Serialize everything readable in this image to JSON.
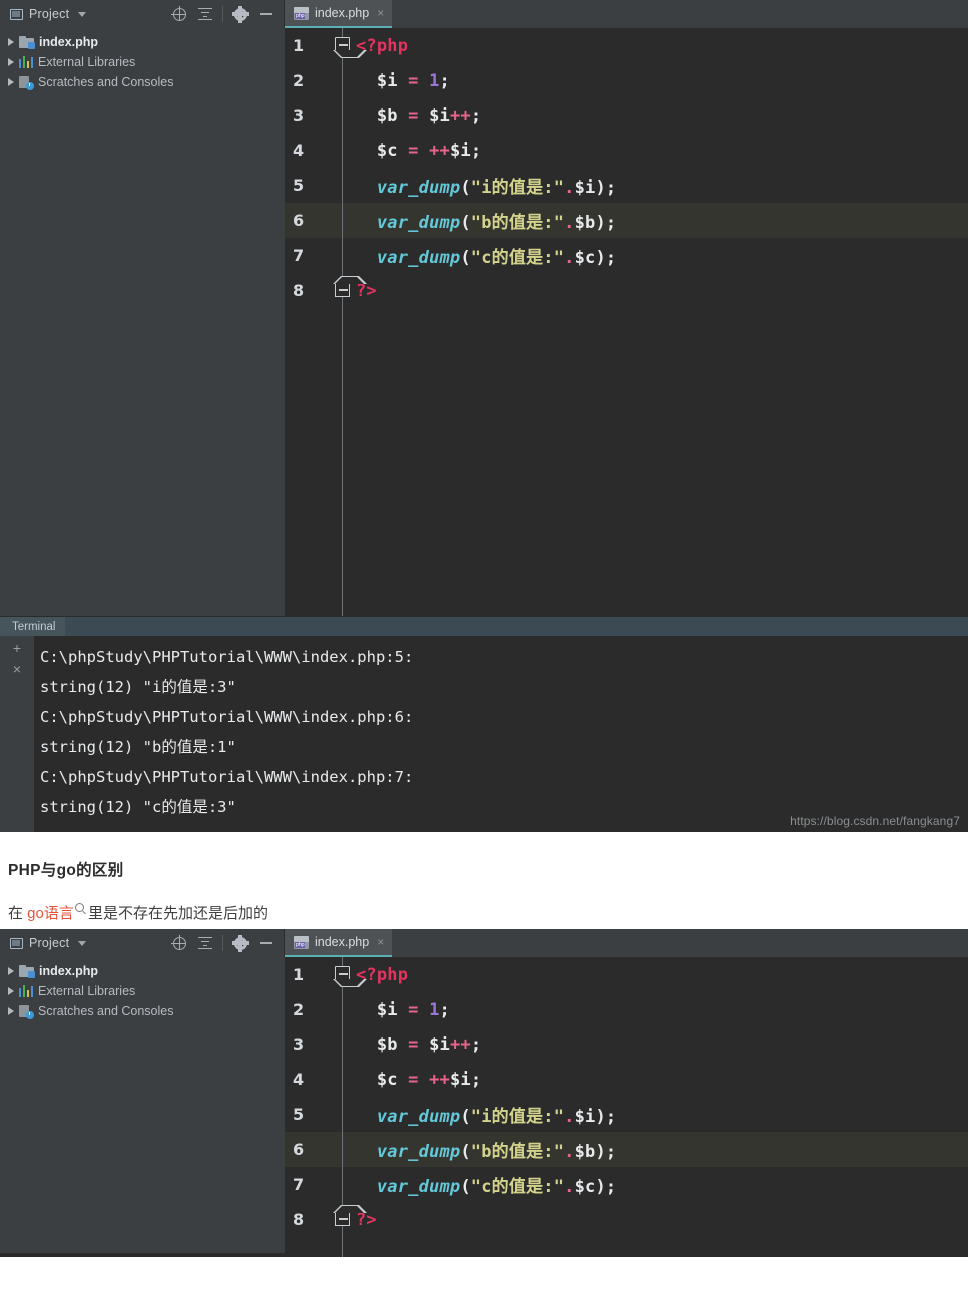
{
  "ide": {
    "project_panel": {
      "title": "Project",
      "icons": [
        "locate-icon",
        "collapse-all-icon",
        "gear-icon",
        "minimize-icon"
      ],
      "tree": [
        {
          "label": "index.php",
          "icon": "folder-icon",
          "bold": true
        },
        {
          "label": "External Libraries",
          "icon": "library-icon",
          "bold": false
        },
        {
          "label": "Scratches and Consoles",
          "icon": "scratches-icon",
          "bold": false
        }
      ]
    },
    "tab": {
      "label": "index.php",
      "close": "×",
      "icon": "php-file-icon",
      "badge": "php"
    },
    "code": {
      "lines": [
        {
          "n": "1",
          "fold": "top",
          "tokens": [
            {
              "t": "tag",
              "v": "<?php"
            }
          ]
        },
        {
          "n": "2",
          "fold": "line",
          "tokens": [
            {
              "t": "var",
              "v": "  $i"
            },
            {
              "t": "op",
              "v": " = "
            },
            {
              "t": "num",
              "v": "1"
            },
            {
              "t": "punc",
              "v": ";"
            }
          ]
        },
        {
          "n": "3",
          "fold": "line",
          "tokens": [
            {
              "t": "var",
              "v": "  $b"
            },
            {
              "t": "op",
              "v": " = "
            },
            {
              "t": "var",
              "v": "$i"
            },
            {
              "t": "op",
              "v": "++"
            },
            {
              "t": "punc",
              "v": ";"
            }
          ]
        },
        {
          "n": "4",
          "fold": "line",
          "tokens": [
            {
              "t": "var",
              "v": "  $c"
            },
            {
              "t": "op",
              "v": " = "
            },
            {
              "t": "op",
              "v": "++"
            },
            {
              "t": "var",
              "v": "$i"
            },
            {
              "t": "punc",
              "v": ";"
            }
          ]
        },
        {
          "n": "5",
          "fold": "line",
          "tokens": [
            {
              "t": "fn",
              "v": "  var_dump"
            },
            {
              "t": "punc",
              "v": "("
            },
            {
              "t": "str",
              "v": "\"i的值是:\""
            },
            {
              "t": "dot",
              "v": "."
            },
            {
              "t": "var",
              "v": "$i"
            },
            {
              "t": "punc",
              "v": ");"
            }
          ]
        },
        {
          "n": "6",
          "fold": "line",
          "hl": true,
          "tokens": [
            {
              "t": "fn",
              "v": "  var_dump"
            },
            {
              "t": "punc",
              "v": "("
            },
            {
              "t": "str",
              "v": "\"b的值是:\""
            },
            {
              "t": "dot",
              "v": "."
            },
            {
              "t": "var",
              "v": "$b"
            },
            {
              "t": "punc",
              "v": ");"
            }
          ]
        },
        {
          "n": "7",
          "fold": "line",
          "tokens": [
            {
              "t": "fn",
              "v": "  var_dump"
            },
            {
              "t": "punc",
              "v": "("
            },
            {
              "t": "str",
              "v": "\"c的值是:\""
            },
            {
              "t": "dot",
              "v": "."
            },
            {
              "t": "var",
              "v": "$c"
            },
            {
              "t": "punc",
              "v": ");"
            }
          ]
        },
        {
          "n": "8",
          "fold": "bot",
          "tokens": [
            {
              "t": "tag",
              "v": "?>"
            }
          ]
        }
      ]
    },
    "terminal": {
      "tab_label": "Terminal",
      "buttons": [
        "+",
        "×"
      ],
      "output": "C:\\phpStudy\\PHPTutorial\\WWW\\index.php:5:\nstring(12) \"i的值是:3\"\nC:\\phpStudy\\PHPTutorial\\WWW\\index.php:6:\nstring(12) \"b的值是:1\"\nC:\\phpStudy\\PHPTutorial\\WWW\\index.php:7:\nstring(12) \"c的值是:3\"",
      "watermark": "https://blog.csdn.net/fangkang7"
    }
  },
  "article": {
    "heading": "PHP与go的区别",
    "paragraph_pre": "在 ",
    "paragraph_link": "go语言",
    "paragraph_post": " 里是不存在先加还是后加的"
  },
  "colors": {
    "editor_bg": "#2b2b2b",
    "panel_bg": "#3c3f41",
    "tab_active_underline": "#5bb0b5",
    "terminal_tabbar": "#3c4b53",
    "highlight_line": "#353530",
    "tag": "#e4335f",
    "operator": "#e8648c",
    "number": "#9a76d8",
    "function": "#63c8d8",
    "string": "#d3d38d",
    "link": "#e5533c"
  }
}
